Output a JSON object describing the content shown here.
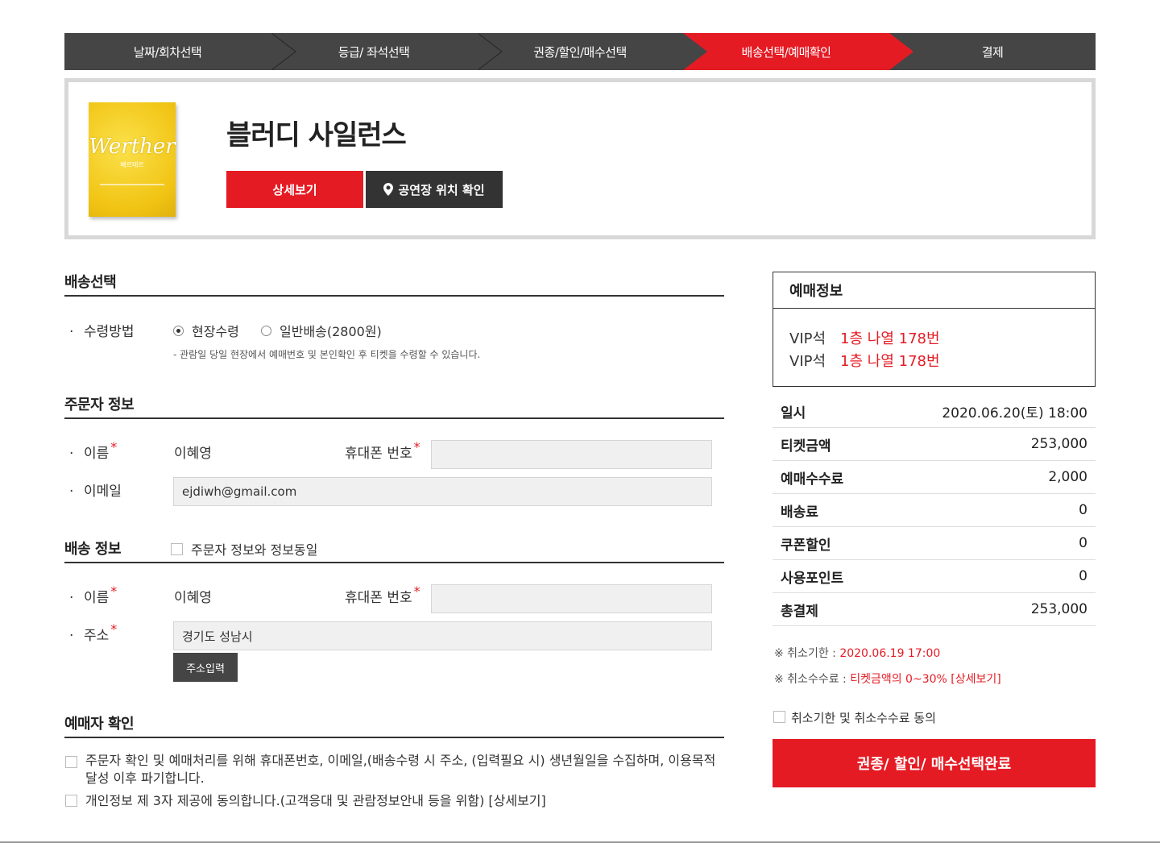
{
  "steps": [
    "날짜/회차선택",
    "등급/ 좌석선택",
    "권종/할인/매수선택",
    "배송선택/예매확인",
    "결제"
  ],
  "active_step": 3,
  "show": {
    "title": "블러디 사일런스",
    "poster_title": "Werther",
    "poster_subtitle": "베르테르",
    "detail_button": "상세보기",
    "venue_button": "공연장 위치 확인"
  },
  "delivery": {
    "section_title": "배송선택",
    "method_label": "수령방법",
    "options": [
      "현장수령",
      "일반배송(2800원)"
    ],
    "selected": 0,
    "note": "- 관람일 당일 현장에서 예매번호 및 본인확인 후 티켓을 수령할 수 있습니다."
  },
  "orderer": {
    "section_title": "주문자 정보",
    "name_label": "이름",
    "name_value": "이혜영",
    "phone_label": "휴대폰 번호",
    "phone_value": "",
    "email_label": "이메일",
    "email_value": "ejdiwh@gmail.com"
  },
  "shipping": {
    "section_title": "배송 정보",
    "same_label": "주문자 정보와 정보동일",
    "name_label": "이름",
    "name_value": "이혜영",
    "phone_label": "휴대폰 번호",
    "phone_value": "",
    "address_label": "주소",
    "address_value": "경기도 성남시",
    "address_button": "주소입력"
  },
  "confirm": {
    "section_title": "예매자 확인",
    "agree1": "주문자 확인 및 예매처리를 위해 휴대폰번호, 이메일,(배송수령 시 주소, (입력필요 시) 생년월일을 수집하며, 이용목적 달성 이후 파기합니다.",
    "agree2": "개인정보 제 3자 제공에 동의합니다.(고객응대 및 관람정보안내 등을 위함) [상세보기]"
  },
  "booking": {
    "title": "예매정보",
    "seats": [
      {
        "grade": "VIP석",
        "seat": "1층 나열 178번"
      },
      {
        "grade": "VIP석",
        "seat": "1층 나열 178번"
      }
    ]
  },
  "prices": [
    {
      "label": "일시",
      "value": "2020.06.20(토) 18:00"
    },
    {
      "label": "티켓금액",
      "value": "253,000"
    },
    {
      "label": "예매수수료",
      "value": "2,000"
    },
    {
      "label": "배송료",
      "value": "0"
    },
    {
      "label": "쿠폰할인",
      "value": "0"
    },
    {
      "label": "사용포인트",
      "value": "0"
    },
    {
      "label": "총결제",
      "value": "253,000"
    }
  ],
  "cancel": {
    "deadline_label": "※ 취소기한 : ",
    "deadline_value": "2020.06.19 17:00",
    "fee_label": "※ 취소수수료 : ",
    "fee_value": "티켓금액의 0~30% [상세보기]",
    "agree_label": "취소기한 및 취소수수료 동의"
  },
  "complete_button": "권종/ 할인/ 매수선택완료",
  "colors": {
    "accent": "#e51b24",
    "dark": "#454545"
  }
}
